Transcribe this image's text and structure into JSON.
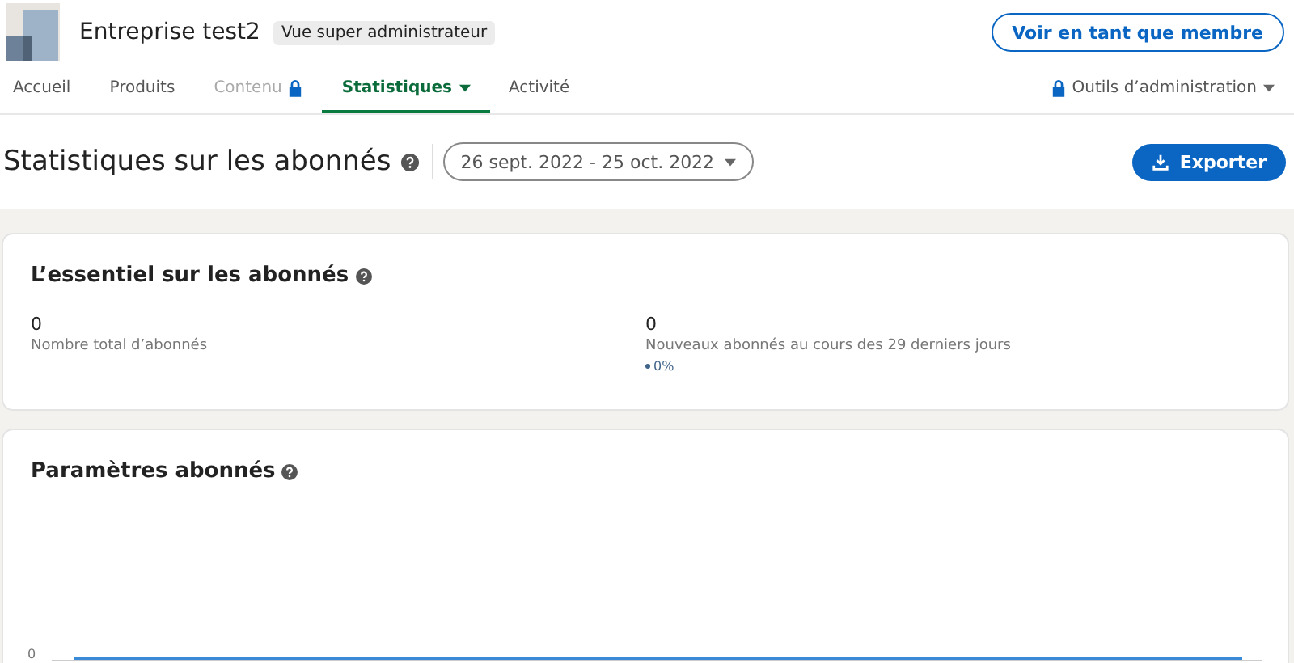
{
  "header": {
    "company": "Entreprise test2",
    "badge": "Vue super administrateur",
    "view_button": "Voir en tant que membre"
  },
  "tabs": [
    {
      "label": "Accueil",
      "selected": false,
      "locked": false,
      "menu": false
    },
    {
      "label": "Produits",
      "selected": false,
      "locked": false,
      "menu": false
    },
    {
      "label": "Contenu",
      "selected": false,
      "locked": true,
      "menu": false
    },
    {
      "label": "Statistiques",
      "selected": true,
      "locked": false,
      "menu": true
    },
    {
      "label": "Activité",
      "selected": false,
      "locked": false,
      "menu": false
    }
  ],
  "admin_tools": {
    "label": "Outils d’administration"
  },
  "page": {
    "title": "Statistiques sur les abonnés",
    "date_range": "26 sept. 2022 - 25 oct. 2022",
    "export_button": "Exporter"
  },
  "highlights": {
    "title": "L’essentiel sur les abonnés",
    "metrics": [
      {
        "value": "0",
        "label": "Nombre total d’abonnés"
      },
      {
        "value": "0",
        "label": "Nouveaux abonnés au cours des 29 derniers jours",
        "change": "0%"
      }
    ]
  },
  "parameters": {
    "title": "Paramètres abonnés",
    "y_tick": "0"
  }
}
